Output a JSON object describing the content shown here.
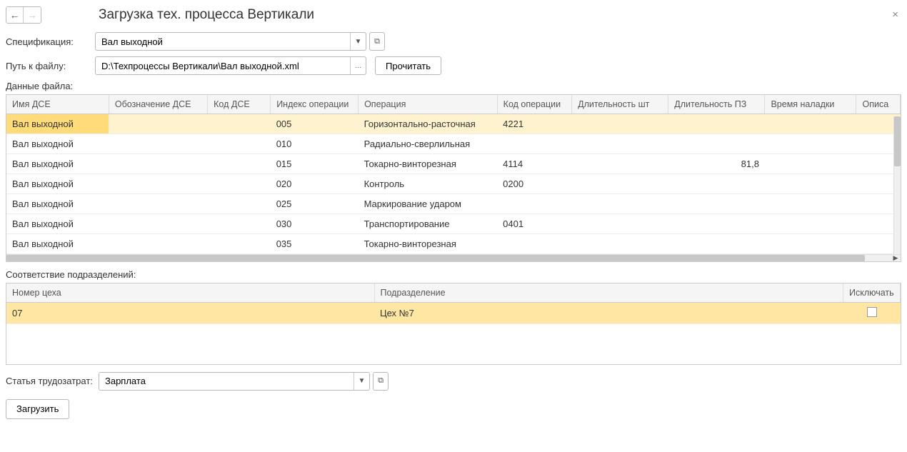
{
  "header": {
    "title": "Загрузка тех. процесса Вертикали"
  },
  "form": {
    "spec_label": "Спецификация:",
    "spec_value": "Вал выходной",
    "path_label": "Путь к файлу:",
    "path_value": "D:\\Техпроцессы Вертикали\\Вал выходной.xml",
    "read_btn": "Прочитать"
  },
  "file_data_label": "Данные файла:",
  "table1": {
    "headers": [
      "Имя ДСЕ",
      "Обозначение ДСЕ",
      "Код ДСЕ",
      "Индекс операции",
      "Операция",
      "Код операции",
      "Длительность шт",
      "Длительность ПЗ",
      "Время наладки",
      "Описа"
    ],
    "rows": [
      {
        "name": "Вал выходной",
        "oboz": "",
        "kod": "",
        "idx": "005",
        "op": "Горизонтально-расточная",
        "opcode": "4221",
        "dsh": "",
        "dpz": "",
        "vn": ""
      },
      {
        "name": "Вал выходной",
        "oboz": "",
        "kod": "",
        "idx": "010",
        "op": "Радиально-сверлильная",
        "opcode": "",
        "dsh": "",
        "dpz": "",
        "vn": ""
      },
      {
        "name": "Вал выходной",
        "oboz": "",
        "kod": "",
        "idx": "015",
        "op": "Токарно-винторезная",
        "opcode": "4114",
        "dsh": "",
        "dpz": "81,8",
        "vn": ""
      },
      {
        "name": "Вал выходной",
        "oboz": "",
        "kod": "",
        "idx": "020",
        "op": "Контроль",
        "opcode": "0200",
        "dsh": "",
        "dpz": "",
        "vn": ""
      },
      {
        "name": "Вал выходной",
        "oboz": "",
        "kod": "",
        "idx": "025",
        "op": "Маркирование ударом",
        "opcode": "",
        "dsh": "",
        "dpz": "",
        "vn": ""
      },
      {
        "name": "Вал выходной",
        "oboz": "",
        "kod": "",
        "idx": "030",
        "op": "Транспортирование",
        "opcode": "0401",
        "dsh": "",
        "dpz": "",
        "vn": ""
      },
      {
        "name": "Вал выходной",
        "oboz": "",
        "kod": "",
        "idx": "035",
        "op": "Токарно-винторезная",
        "opcode": "",
        "dsh": "",
        "dpz": "",
        "vn": ""
      }
    ]
  },
  "dept_label": "Соответствие подразделений:",
  "table2": {
    "headers": [
      "Номер цеха",
      "Подразделение",
      "Исключать"
    ],
    "rows": [
      {
        "num": "07",
        "dept": "Цех №7",
        "excl": false
      }
    ]
  },
  "labor": {
    "label": "Статья трудозатрат:",
    "value": "Зарплата"
  },
  "load_btn": "Загрузить"
}
